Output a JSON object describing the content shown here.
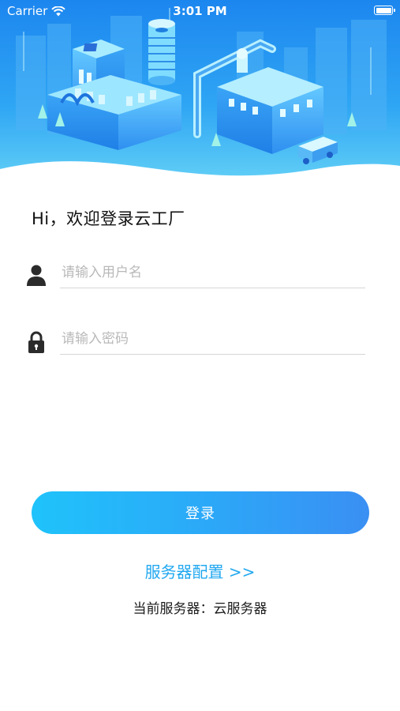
{
  "status_bar": {
    "carrier": "Carrier",
    "time": "3:01 PM"
  },
  "greeting": "Hi，欢迎登录云工厂",
  "username": {
    "placeholder": "请输入用户名",
    "value": "",
    "icon": "user-icon"
  },
  "password": {
    "placeholder": "请输入密码",
    "value": "",
    "icon": "lock-icon"
  },
  "login_button": "登录",
  "server_config_link": "服务器配置 >>",
  "current_server": {
    "label": "当前服务器：",
    "value": "云服务器"
  },
  "colors": {
    "accent": "#22a8f0",
    "button_start": "#1fc3fb",
    "button_end": "#3a8ff3",
    "hero_top": "#1e8ff0",
    "hero_bottom": "#5fd3f7"
  }
}
